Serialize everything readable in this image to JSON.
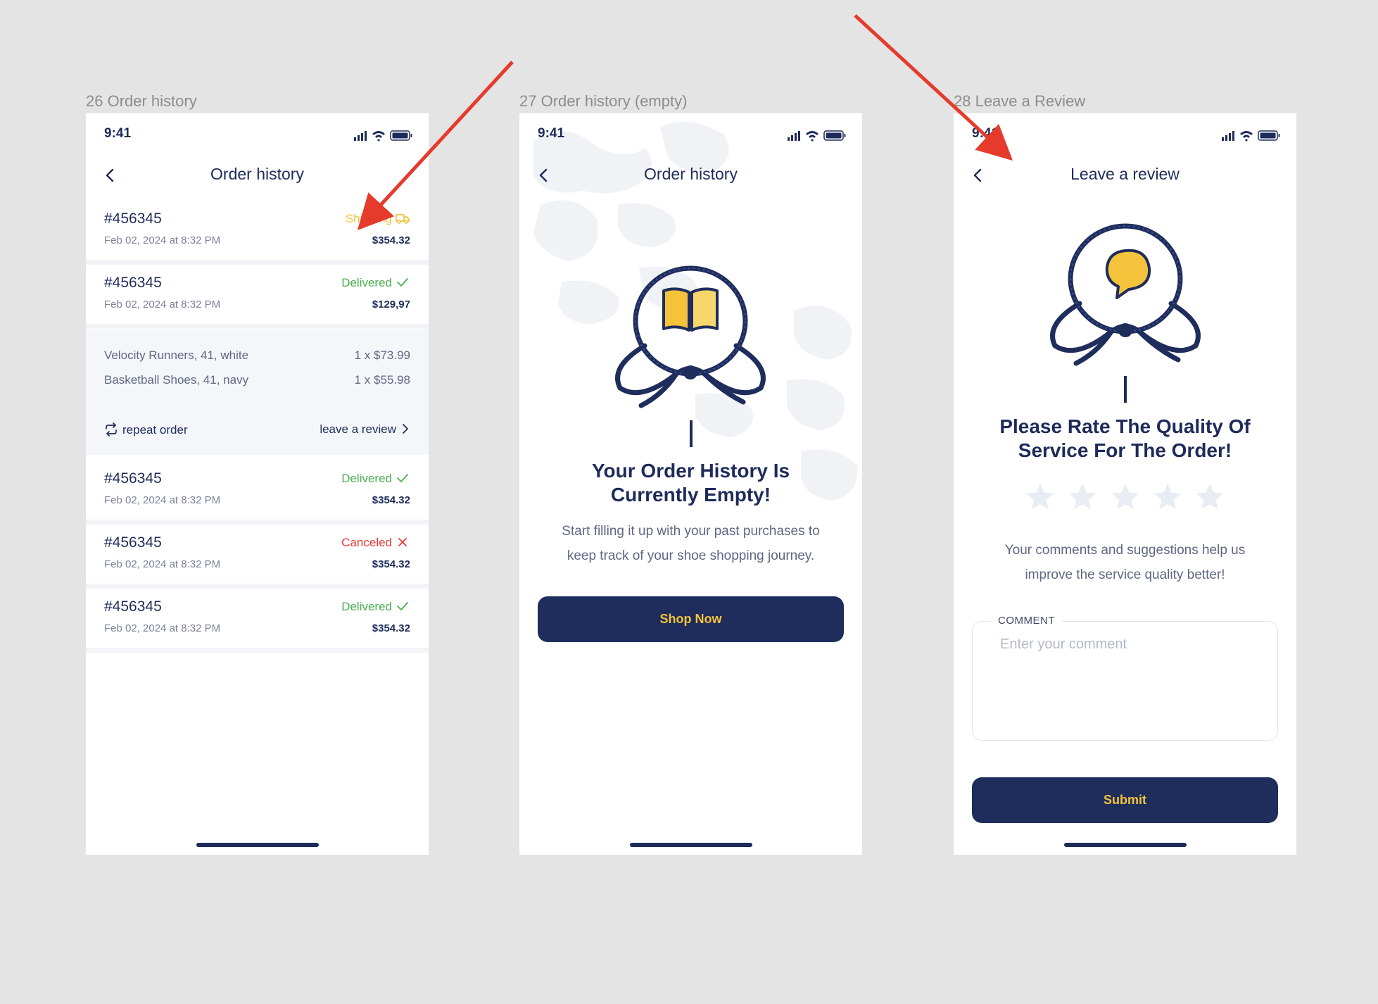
{
  "frames": [
    {
      "label": "26 Order history"
    },
    {
      "label": "27 Order history (empty)"
    },
    {
      "label": "28 Leave a Review"
    }
  ],
  "status_bar": {
    "time": "9:41"
  },
  "order_history": {
    "title": "Order history",
    "orders": [
      {
        "number": "#456345",
        "date": "Feb 02, 2024 at 8:32 PM",
        "status": "Shipping",
        "price": "$354.32"
      },
      {
        "number": "#456345",
        "date": "Feb 02, 2024 at 8:32 PM",
        "status": "Delivered",
        "price": "$129,97"
      },
      {
        "number": "#456345",
        "date": "Feb 02, 2024 at 8:32 PM",
        "status": "Delivered",
        "price": "$354.32"
      },
      {
        "number": "#456345",
        "date": "Feb 02, 2024 at 8:32 PM",
        "status": "Canceled",
        "price": "$354.32"
      },
      {
        "number": "#456345",
        "date": "Feb 02, 2024 at 8:32 PM",
        "status": "Delivered",
        "price": "$354.32"
      }
    ],
    "expanded_items": [
      {
        "name": "Velocity Runners, 41, white",
        "qty": "1 x $73.99"
      },
      {
        "name": "Basketball Shoes, 41, navy",
        "qty": "1 x $55.98"
      }
    ],
    "repeat_order": "repeat order",
    "leave_review": "leave a review"
  },
  "empty_history": {
    "title": "Order history",
    "heading_line1": "Your Order History Is",
    "heading_line2": "Currently Empty!",
    "body_line1": "Start filling it up with your past purchases to",
    "body_line2": "keep track of your shoe shopping journey.",
    "button": "Shop Now"
  },
  "review": {
    "title": "Leave a review",
    "heading_line1": "Please Rate The Quality Of",
    "heading_line2": "Service For The Order!",
    "rating": 0,
    "max_rating": 5,
    "body_line1": "Your comments and suggestions help us",
    "body_line2": "improve the service quality better!",
    "comment_label": "COMMENT",
    "comment_placeholder": "Enter your comment",
    "button": "Submit"
  },
  "colors": {
    "navy": "#1e2b5a",
    "accent_yellow": "#f4c33b",
    "delivered": "#4caf50",
    "canceled": "#e53935",
    "annotation_arrow": "#e53a2c"
  }
}
